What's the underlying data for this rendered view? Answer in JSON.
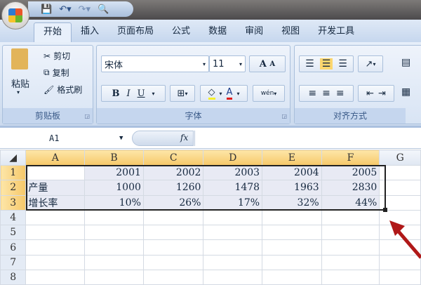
{
  "tabs": [
    "开始",
    "插入",
    "页面布局",
    "公式",
    "数据",
    "审阅",
    "视图",
    "开发工具"
  ],
  "clipboard": {
    "paste": "粘贴",
    "cut": "剪切",
    "copy": "复制",
    "format_painter": "格式刷",
    "group": "剪贴板"
  },
  "font": {
    "name": "宋体",
    "size": "11",
    "bold": "B",
    "italic": "I",
    "underline": "U",
    "grow": "A",
    "shrink": "A",
    "phonetic": "wén",
    "group": "字体"
  },
  "alignment": {
    "group": "对齐方式"
  },
  "name_box": "A1",
  "fx": "fx",
  "columns": [
    "A",
    "B",
    "C",
    "D",
    "E",
    "F",
    "G"
  ],
  "rows": [
    {
      "n": "1",
      "cells": [
        "",
        "2001",
        "2002",
        "2003",
        "2004",
        "2005"
      ]
    },
    {
      "n": "2",
      "cells": [
        "产量",
        "1000",
        "1260",
        "1478",
        "1963",
        "2830"
      ]
    },
    {
      "n": "3",
      "cells": [
        "增长率",
        "10%",
        "26%",
        "17%",
        "32%",
        "44%"
      ]
    },
    {
      "n": "4",
      "cells": []
    },
    {
      "n": "5",
      "cells": []
    },
    {
      "n": "6",
      "cells": []
    },
    {
      "n": "7",
      "cells": []
    },
    {
      "n": "8",
      "cells": []
    }
  ],
  "colors": {
    "selection": "#e8eaf4",
    "header_active": "#f6c869",
    "arrow": "#b01818"
  }
}
